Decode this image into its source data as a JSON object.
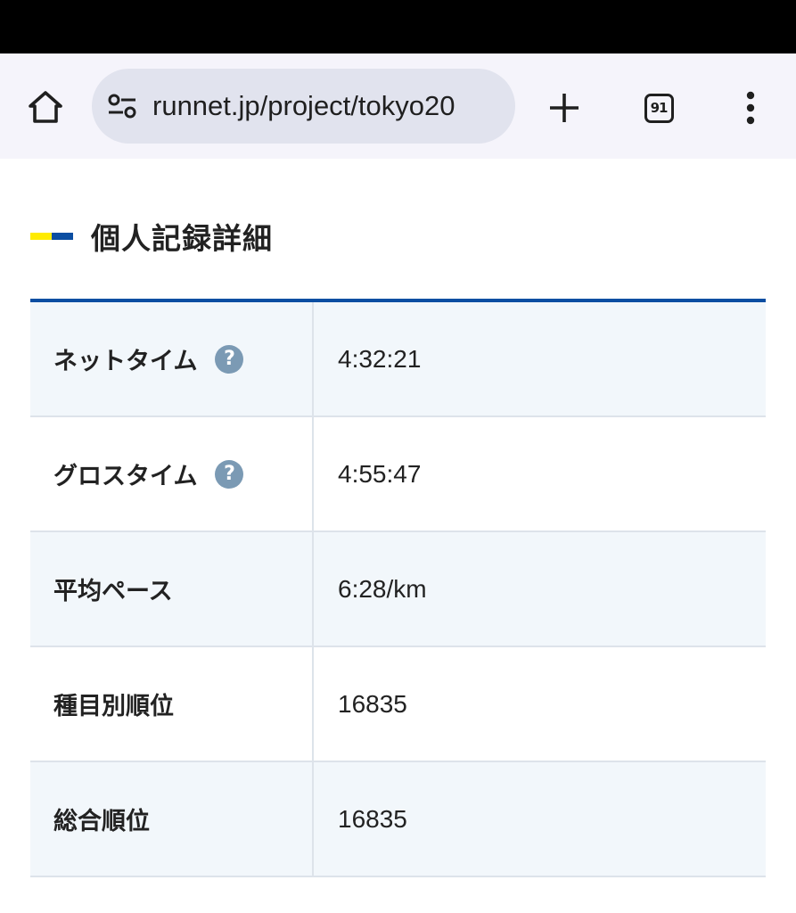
{
  "browser": {
    "url": "runnet.jp/project/tokyo20",
    "tab_count": "91"
  },
  "icons": {
    "home": "home-icon",
    "site_info": "tune-icon",
    "new_tab": "plus-icon",
    "menu": "more-vert-icon",
    "help": "question-icon"
  },
  "colors": {
    "accent_blue": "#0b4ea2",
    "accent_yellow": "#ffeb00",
    "help_icon": "#7b9ab4"
  },
  "section": {
    "title": "個人記録詳細"
  },
  "records": [
    {
      "label": "ネットタイム",
      "value": "4:32:21",
      "help": "?"
    },
    {
      "label": "グロスタイム",
      "value": "4:55:47",
      "help": "?"
    },
    {
      "label": "平均ペース",
      "value": "6:28/km"
    },
    {
      "label": "種目別順位",
      "value": "16835"
    },
    {
      "label": "総合順位",
      "value": "16835"
    }
  ]
}
